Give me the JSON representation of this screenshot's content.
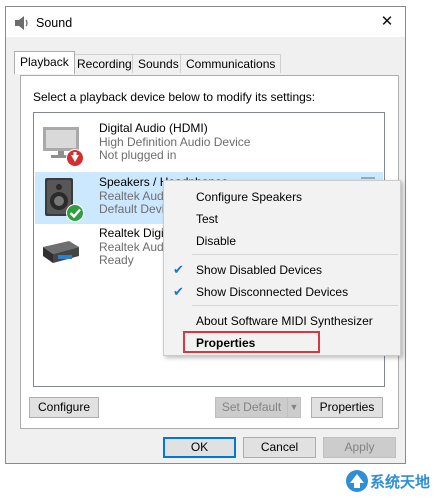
{
  "window": {
    "title": "Sound",
    "close_glyph": "✕",
    "app_icon": "speaker-icon"
  },
  "tabs": [
    {
      "label": "Playback",
      "active": true
    },
    {
      "label": "Recording",
      "active": false
    },
    {
      "label": "Sounds",
      "active": false
    },
    {
      "label": "Communications",
      "active": false
    }
  ],
  "panel": {
    "instruction": "Select a playback device below to modify its settings:"
  },
  "devices": [
    {
      "name": "Digital Audio (HDMI)",
      "line2": "High Definition Audio Device",
      "line3": "Not plugged in",
      "icon": "monitor-icon",
      "status_icon": "red-down-arrow-icon",
      "selected": false
    },
    {
      "name": "Speakers / Headphones",
      "line2": "Realtek Audio",
      "line3": "Default Device",
      "icon": "speaker-icon",
      "status_icon": "green-check-icon",
      "selected": true
    },
    {
      "name": "Realtek Digital",
      "line2": "Realtek Audio",
      "line3": "Ready",
      "icon": "digital-output-icon",
      "status_icon": "",
      "selected": false
    }
  ],
  "context_menu": {
    "items": [
      {
        "label": "Configure Speakers",
        "checked": false,
        "bold": false
      },
      {
        "label": "Test",
        "checked": false,
        "bold": false
      },
      {
        "label": "Disable",
        "checked": false,
        "bold": false
      },
      {
        "label": "Show Disabled Devices",
        "checked": true,
        "bold": false
      },
      {
        "label": "Show Disconnected Devices",
        "checked": true,
        "bold": false
      },
      {
        "label": "About Software MIDI Synthesizer",
        "checked": false,
        "bold": false
      },
      {
        "label": "Properties",
        "checked": false,
        "bold": true
      }
    ],
    "check_glyph": "✔"
  },
  "buttons": {
    "configure": "Configure",
    "set_default": "Set Default",
    "properties": "Properties",
    "ok": "OK",
    "cancel": "Cancel",
    "apply": "Apply"
  },
  "watermark": {
    "text": "系统天地"
  },
  "colors": {
    "selection": "#cce8ff",
    "accent": "#0078d7",
    "highlight_box": "#d9363e",
    "check": "#1b74c8"
  }
}
